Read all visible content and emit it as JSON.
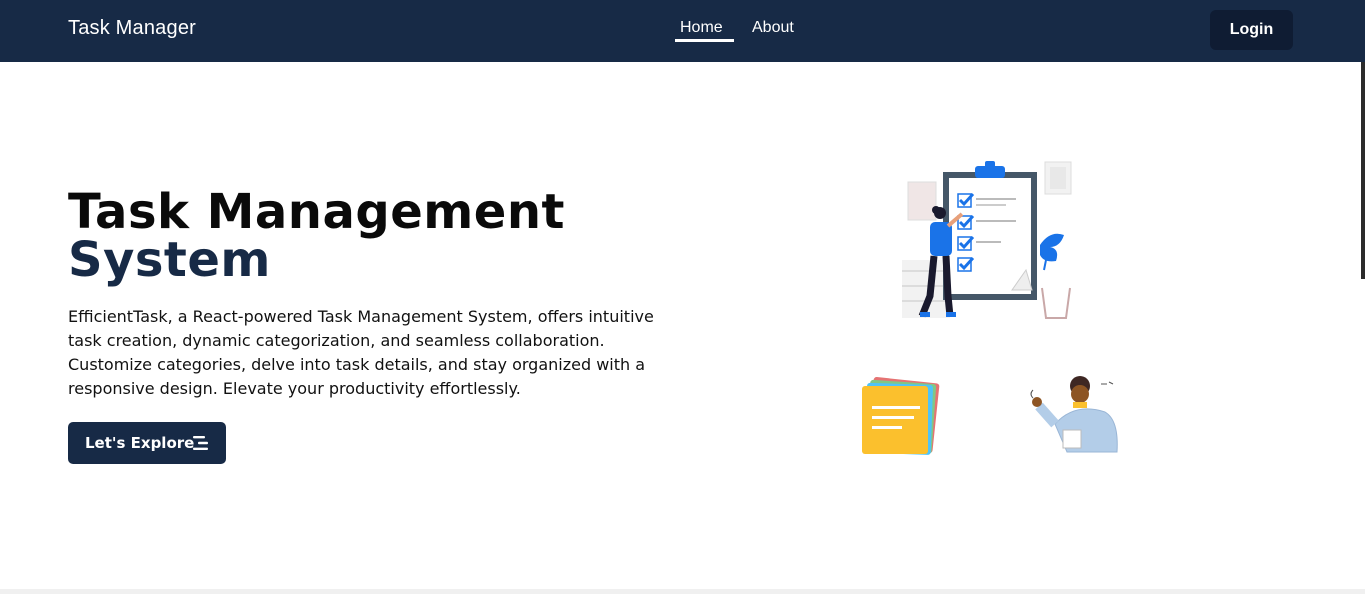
{
  "navbar": {
    "brand": "Task Manager",
    "links": [
      {
        "label": "Home",
        "active": true
      },
      {
        "label": "About",
        "active": false
      }
    ],
    "login_label": "Login"
  },
  "hero": {
    "title_line1": "Task Management",
    "title_line2": "System",
    "description": "EfficientTask, a React-powered Task Management System, offers intuitive task creation, dynamic categorization, and seamless collaboration. Customize categories, delve into task details, and stay organized with a responsive design. Elevate your productivity effortlessly.",
    "cta_label": "Let's Explore",
    "cta_icon": "menu-icon"
  },
  "illustrations": [
    {
      "icon": "checklist-illustration"
    },
    {
      "icon": "sticky-notes-illustration"
    },
    {
      "icon": "person-pointing-illustration"
    }
  ],
  "colors": {
    "navbar_bg": "#172a46",
    "accent_blue": "#1a73e8",
    "title_dark": "#0a0a0a",
    "title_navy": "#172a46"
  }
}
